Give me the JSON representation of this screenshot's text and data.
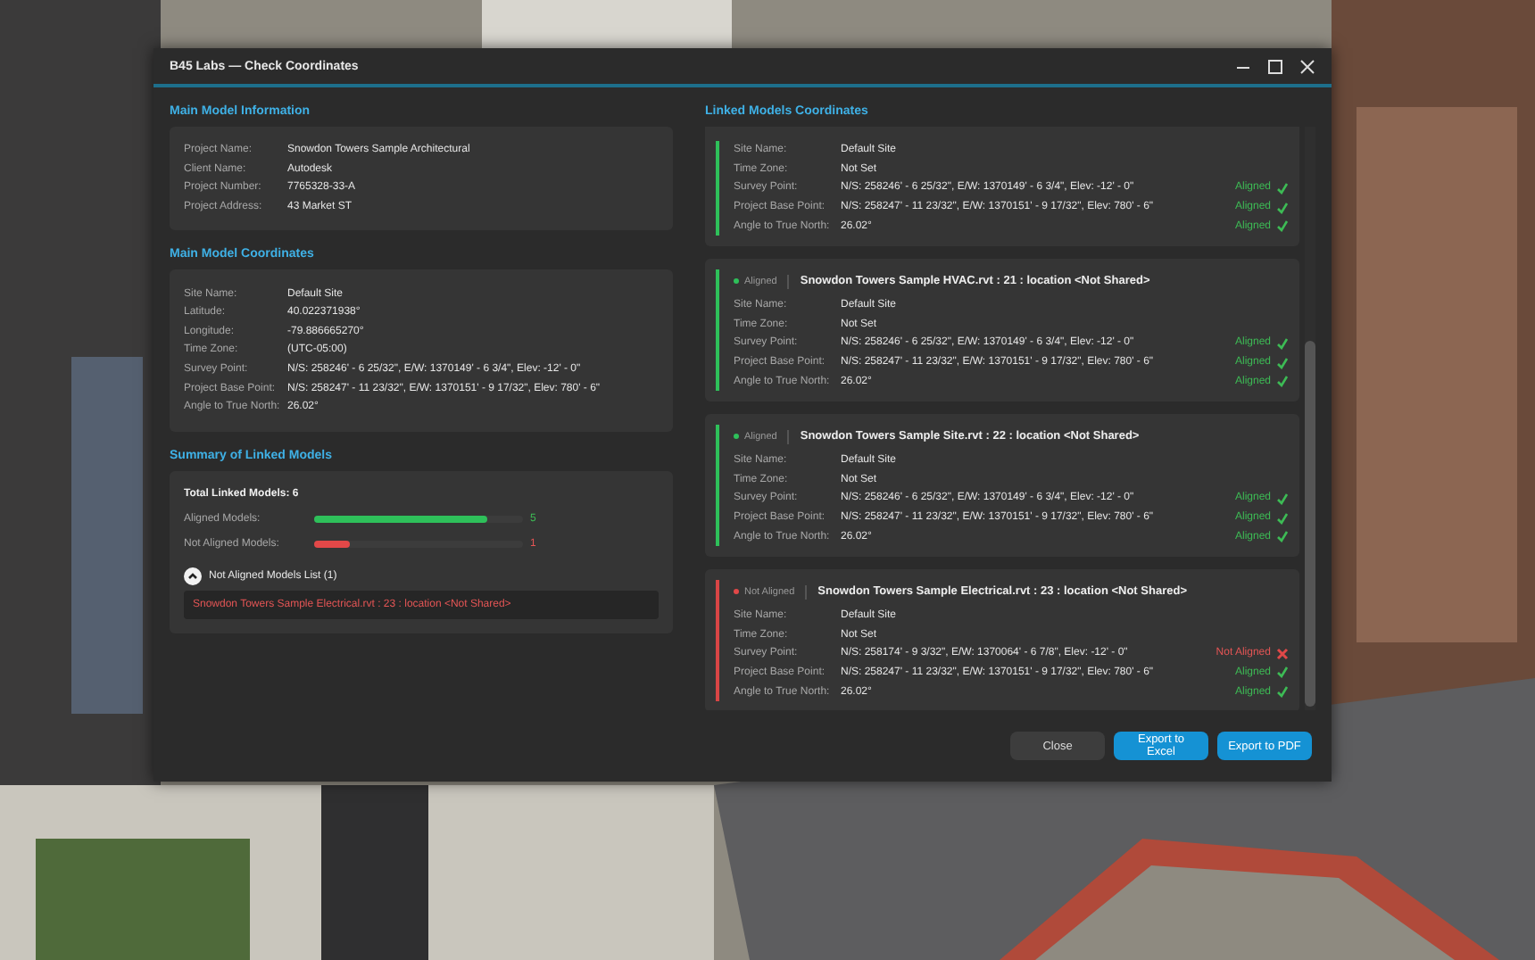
{
  "window": {
    "title": "B45 Labs — Check Coordinates"
  },
  "main_info": {
    "title": "Main Model Information",
    "rows": [
      {
        "label": "Project Name:",
        "value": "Snowdon Towers Sample Architectural"
      },
      {
        "label": "Client Name:",
        "value": "Autodesk"
      },
      {
        "label": "Project Number:",
        "value": "7765328-33-A"
      },
      {
        "label": "Project Address:",
        "value": "43 Market ST"
      }
    ]
  },
  "main_coords": {
    "title": "Main Model Coordinates",
    "rows": [
      {
        "label": "Site Name:",
        "value": "Default Site"
      },
      {
        "label": "Latitude:",
        "value": "40.022371938°"
      },
      {
        "label": "Longitude:",
        "value": "-79.886665270°"
      },
      {
        "label": "Time Zone:",
        "value": "(UTC-05:00)"
      },
      {
        "label": "Survey Point:",
        "value": "N/S: 258246' - 6 25/32\", E/W: 1370149' - 6 3/4\", Elev: -12' - 0\""
      },
      {
        "label": "Project Base Point:",
        "value": "N/S: 258247' - 11 23/32\", E/W: 1370151' - 9 17/32\", Elev: 780' - 6\""
      },
      {
        "label": "Angle to True North:",
        "value": "26.02°"
      }
    ]
  },
  "summary": {
    "title": "Summary of Linked Models",
    "total": "Total Linked Models: 6",
    "bars": [
      {
        "label": "Aligned Models:",
        "level": 0.83,
        "count": "5",
        "kind": "ok"
      },
      {
        "label": "Not Aligned Models:",
        "level": 0.17,
        "count": "1",
        "kind": "bad"
      }
    ],
    "list_title": "Not Aligned Models List (1)",
    "expanded": true,
    "items": [
      "Snowdon Towers Sample Electrical.rvt : 23 : location <Not Shared>"
    ]
  },
  "linked": {
    "title": "Linked Models Coordinates",
    "cards": [
      {
        "aligned": true,
        "rows": [
          {
            "label": "Site Name:",
            "value": "Default Site"
          },
          {
            "label": "Time Zone:",
            "value": "Not Set"
          },
          {
            "label": "Survey Point:",
            "value": "N/S: 258246' - 6 25/32\", E/W: 1370149' - 6 3/4\", Elev: -12' - 0\"",
            "status": "Aligned",
            "aligned": true
          },
          {
            "label": "Project Base Point:",
            "value": "N/S: 258247' - 11 23/32\", E/W: 1370151' - 9 17/32\", Elev: 780' - 6\"",
            "status": "Aligned",
            "aligned": true
          },
          {
            "label": "Angle to True North:",
            "value": "26.02°",
            "status": "Aligned",
            "aligned": true
          }
        ]
      },
      {
        "aligned": true,
        "badge": "Aligned",
        "name": "Snowdon Towers Sample HVAC.rvt : 21 : location <Not Shared>",
        "rows": [
          {
            "label": "Site Name:",
            "value": "Default Site"
          },
          {
            "label": "Time Zone:",
            "value": "Not Set"
          },
          {
            "label": "Survey Point:",
            "value": "N/S: 258246' - 6 25/32\", E/W: 1370149' - 6 3/4\", Elev: -12' - 0\"",
            "status": "Aligned",
            "aligned": true
          },
          {
            "label": "Project Base Point:",
            "value": "N/S: 258247' - 11 23/32\", E/W: 1370151' - 9 17/32\", Elev: 780' - 6\"",
            "status": "Aligned",
            "aligned": true
          },
          {
            "label": "Angle to True North:",
            "value": "26.02°",
            "status": "Aligned",
            "aligned": true
          }
        ]
      },
      {
        "aligned": true,
        "badge": "Aligned",
        "name": "Snowdon Towers Sample Site.rvt : 22 : location <Not Shared>",
        "rows": [
          {
            "label": "Site Name:",
            "value": "Default Site"
          },
          {
            "label": "Time Zone:",
            "value": "Not Set"
          },
          {
            "label": "Survey Point:",
            "value": "N/S: 258246' - 6 25/32\", E/W: 1370149' - 6 3/4\", Elev: -12' - 0\"",
            "status": "Aligned",
            "aligned": true
          },
          {
            "label": "Project Base Point:",
            "value": "N/S: 258247' - 11 23/32\", E/W: 1370151' - 9 17/32\", Elev: 780' - 6\"",
            "status": "Aligned",
            "aligned": true
          },
          {
            "label": "Angle to True North:",
            "value": "26.02°",
            "status": "Aligned",
            "aligned": true
          }
        ]
      },
      {
        "aligned": false,
        "badge": "Not Aligned",
        "name": "Snowdon Towers Sample Electrical.rvt : 23 : location <Not Shared>",
        "rows": [
          {
            "label": "Site Name:",
            "value": "Default Site"
          },
          {
            "label": "Time Zone:",
            "value": "Not Set"
          },
          {
            "label": "Survey Point:",
            "value": "N/S: 258174' - 9 3/32\", E/W: 1370064' - 6 7/8\", Elev: -12' - 0\"",
            "status": "Not Aligned",
            "aligned": false
          },
          {
            "label": "Project Base Point:",
            "value": "N/S: 258247' - 11 23/32\", E/W: 1370151' - 9 17/32\", Elev: 780' - 6\"",
            "status": "Aligned",
            "aligned": true
          },
          {
            "label": "Angle to True North:",
            "value": "26.02°",
            "status": "Aligned",
            "aligned": true
          }
        ]
      }
    ]
  },
  "buttons": [
    {
      "label": "Close",
      "kind": "secondary"
    },
    {
      "label": "Export to Excel",
      "kind": "primary"
    },
    {
      "label": "Export to PDF",
      "kind": "primary"
    }
  ]
}
